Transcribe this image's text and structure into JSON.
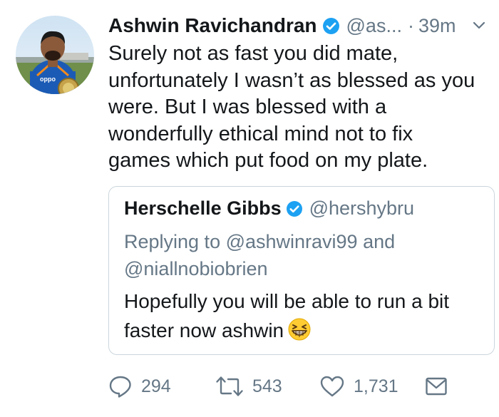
{
  "tweet": {
    "author_name": "Ashwin Ravichandran",
    "handle": "@as...",
    "separator": "·",
    "time": "39m",
    "text_lines": [
      "Surely not as fast you did mate,",
      "unfortunately I wasn’t as blessed as you",
      "were. But I was blessed with a",
      "wonderfully ethical mind not to fix",
      "games which put food on my plate."
    ],
    "avatar_icon": "profile-photo",
    "verified_icon": "verified-badge-icon",
    "menu_icon": "chevron-down-icon"
  },
  "quoted_tweet": {
    "author_name": "Herschelle Gibbs",
    "handle": "@hershybru",
    "reply_lines": [
      "Replying to @ashwinravi99 and",
      "@niallnobiobrien"
    ],
    "text_lines": [
      "Hopefully you will be able to run a bit",
      "faster now ashwin"
    ],
    "emoji": "grinning-squinting-face-emoji"
  },
  "actions": {
    "reply_count": "294",
    "retweet_count": "543",
    "like_count": "1,731",
    "reply_icon": "reply-bubble-icon",
    "retweet_icon": "retweet-icon",
    "like_icon": "heart-icon",
    "dm_icon": "envelope-icon"
  },
  "colors": {
    "text": "#14171a",
    "secondary": "#657786",
    "verified": "#1da1f2",
    "border": "#ccd6dd"
  }
}
